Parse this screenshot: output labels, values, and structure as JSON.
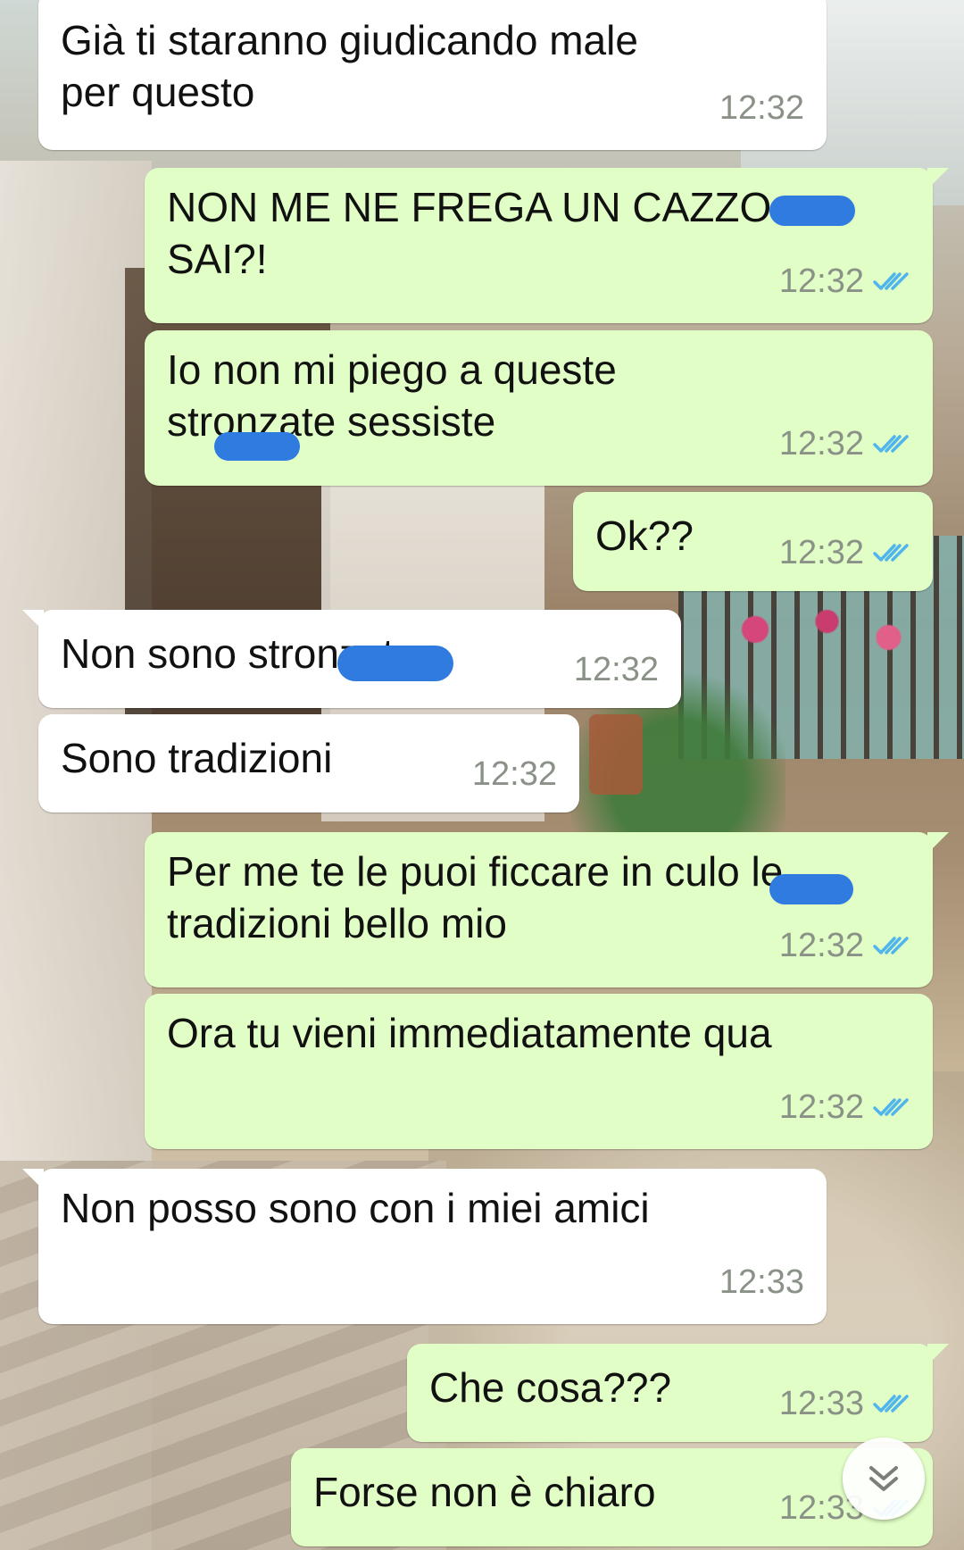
{
  "chat": {
    "messages": [
      {
        "direction": "in",
        "text": "Già ti staranno giudicando male\nper questo",
        "time": "12:32"
      },
      {
        "direction": "out",
        "text": "NON ME NE FREGA UN CAZZO\nSAI?!",
        "time": "12:32",
        "status": "read"
      },
      {
        "direction": "out",
        "text": "Io non mi piego a queste\nstronzate sessiste",
        "time": "12:32",
        "status": "read"
      },
      {
        "direction": "out",
        "text": "Ok??",
        "time": "12:32",
        "status": "read"
      },
      {
        "direction": "in",
        "text": "Non sono stronzate",
        "time": "12:32"
      },
      {
        "direction": "in",
        "text": "Sono tradizioni",
        "time": "12:32"
      },
      {
        "direction": "out",
        "text": "Per me te le puoi ficcare in culo le\ntradizioni bello mio",
        "time": "12:32",
        "status": "read"
      },
      {
        "direction": "out",
        "text": "Ora tu vieni immediatamente qua",
        "time": "12:32",
        "status": "read"
      },
      {
        "direction": "in",
        "text": "Non posso sono con i miei amici",
        "time": "12:33"
      },
      {
        "direction": "out",
        "text": "Che cosa???",
        "time": "12:33",
        "status": "read"
      },
      {
        "direction": "out",
        "text": "Forse non è chiaro",
        "time": "12:33",
        "status": "read"
      }
    ]
  },
  "colors": {
    "incoming_bubble": "#ffffff",
    "outgoing_bubble": "#e1fec6",
    "read_ticks": "#4fb5ec",
    "redaction": "#2f7bdf",
    "timestamp": "#8a9288"
  },
  "icons": {
    "read_status": "double-check-icon",
    "scroll_down": "chevron-double-down-icon"
  }
}
